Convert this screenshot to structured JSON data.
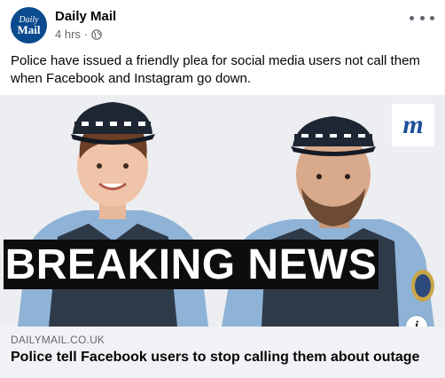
{
  "post": {
    "page_name": "Daily Mail",
    "avatar_line1": "Daily",
    "avatar_line2": "Mail",
    "time": "4 hrs",
    "separator": "·",
    "privacy_icon": "globe-icon",
    "more_icon": "more-options-icon",
    "text": "Police have issued a friendly plea for social media users not call them when Facebook and Instagram go down."
  },
  "media": {
    "banner": "BREAKING NEWS",
    "logo_letter": "m",
    "info_label": "i"
  },
  "link": {
    "domain": "DAILYMAIL.CO.UK",
    "title": "Police tell Facebook users to stop calling them about outage"
  },
  "colors": {
    "brand": "#0a4a8e",
    "muted_text": "#65676b",
    "link_bar_bg": "#f0f2f5",
    "banner_bg": "#0d0d0d"
  }
}
